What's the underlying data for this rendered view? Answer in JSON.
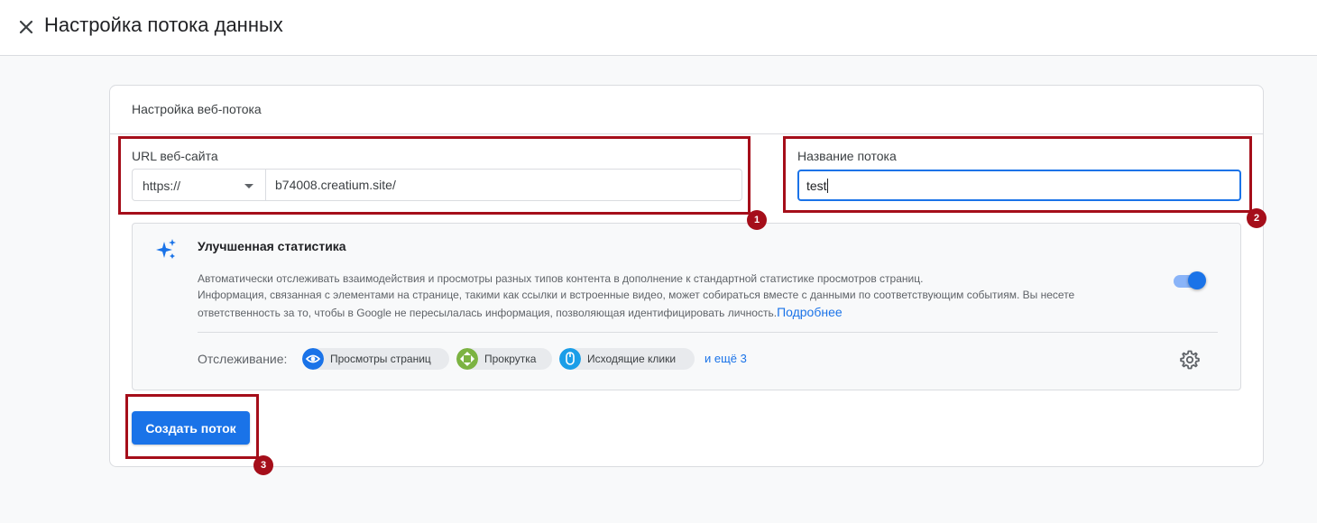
{
  "header": {
    "title": "Настройка потока данных",
    "close_icon": "close-icon"
  },
  "card": {
    "title": "Настройка веб-потока",
    "url_label": "URL веб-сайта",
    "protocol_selected": "https://",
    "url_value": "b74008.creatium.site/",
    "name_label": "Название потока",
    "name_value": "test"
  },
  "enhanced": {
    "icon": "sparkle-icon",
    "title": "Улучшенная статистика",
    "description": "Автоматически отслеживать взаимодействия и просмотры разных типов контента в дополнение к стандартной статистике просмотров страниц.",
    "info_line1": "Информация, связанная с элементами на странице, такими как ссылки и встроенные видео, может собираться вместе с данными по соответствующим событиям. Вы несете",
    "info_line2": "ответственность за то, чтобы в Google не пересылалась информация, позволяющая идентифицировать личность.",
    "more_link": "Подробнее",
    "toggle_on": true,
    "tracking_label": "Отслеживание:",
    "chips": [
      {
        "label": "Просмотры страниц",
        "icon": "eye-icon",
        "color": "#1a73e8"
      },
      {
        "label": "Прокрутка",
        "icon": "scroll-icon",
        "color": "#7cb342"
      },
      {
        "label": "Исходящие клики",
        "icon": "mouse-icon",
        "color": "#1a9ee8"
      }
    ],
    "and_more": "и ещё 3",
    "settings_icon": "gear-icon"
  },
  "actions": {
    "create_label": "Создать поток"
  },
  "annotations": {
    "badge1": "1",
    "badge2": "2",
    "badge3": "3",
    "color": "#a50e1a"
  },
  "colors": {
    "accent": "#1a73e8",
    "toggle_track": "#8ab4f8"
  }
}
